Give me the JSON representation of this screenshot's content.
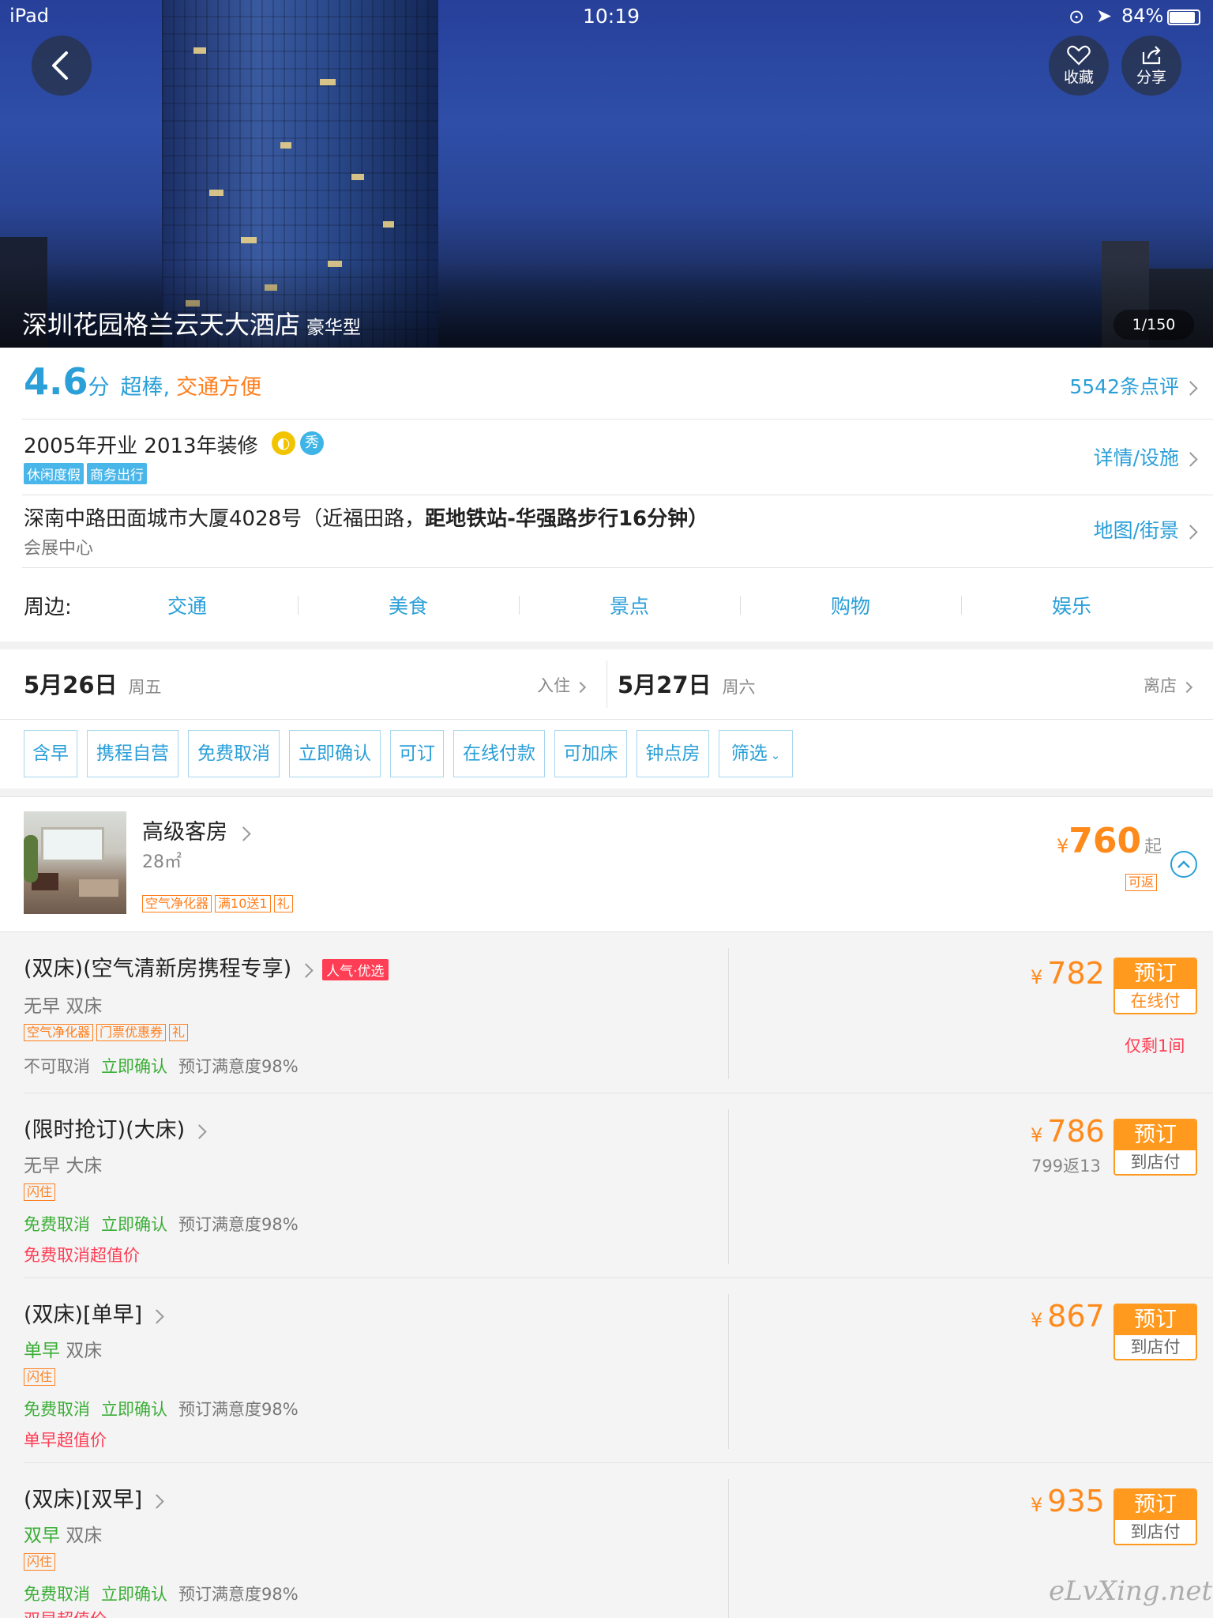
{
  "status_bar": {
    "device": "iPad",
    "time": "10:19",
    "battery": "84%"
  },
  "hero": {
    "name": "深圳花园格兰云天大酒店",
    "type": "豪华型",
    "photo_count": "1/150",
    "fav_label": "收藏",
    "share_label": "分享"
  },
  "rating": {
    "score": "4.6",
    "unit": "分",
    "desc_a": "超棒,",
    "desc_b": "交通方便",
    "reviews": "5542条点评"
  },
  "info": {
    "opening": "2005年开业 2013年装修",
    "badge_show": "秀",
    "tags": [
      "休闲度假",
      "商务出行"
    ],
    "detail_link": "详情/设施"
  },
  "address": {
    "line_a": "深南中路田面城市大厦4028号（近福田路，",
    "line_b": "距地铁站-华强路步行16分钟）",
    "area": "会展中心",
    "map_link": "地图/街景"
  },
  "nearby": {
    "label": "周边:",
    "items": [
      "交通",
      "美食",
      "景点",
      "购物",
      "娱乐"
    ]
  },
  "dates": {
    "checkin": "5月26日",
    "checkin_day": "周五",
    "checkin_label": "入住",
    "checkout": "5月27日",
    "checkout_day": "周六",
    "checkout_label": "离店"
  },
  "filters": [
    "含早",
    "携程自营",
    "免费取消",
    "立即确认",
    "可订",
    "在线付款",
    "可加床",
    "钟点房",
    "筛选"
  ],
  "room": {
    "name": "高级客房",
    "area": "28㎡",
    "tags": [
      "空气净化器",
      "满10送1",
      "礼"
    ],
    "currency": "¥",
    "price": "760",
    "price_suffix": "起",
    "rebate": "可返"
  },
  "rates": [
    {
      "title": "(双床)(空气清新房携程专享)",
      "badge": "人气·优选",
      "meal": "无早",
      "bed": "双床",
      "tags": [
        "空气净化器",
        "门票优惠券",
        "礼"
      ],
      "cancel": "不可取消",
      "confirm": "立即确认",
      "satisfaction": "预订满意度98%",
      "currency": "¥",
      "price": "782",
      "book": "预订",
      "pay": "在线付",
      "extra": "仅剩1间"
    },
    {
      "title": "(限时抢订)(大床)",
      "meal": "无早",
      "bed": "大床",
      "tags": [
        "闪住"
      ],
      "cancel": "免费取消",
      "confirm": "立即确认",
      "satisfaction": "预订满意度98%",
      "note": "免费取消超值价",
      "currency": "¥",
      "price": "786",
      "sub_price": "799返13",
      "book": "预订",
      "pay": "到店付"
    },
    {
      "title": "(双床)[单早]",
      "meal": "单早",
      "bed": "双床",
      "tags": [
        "闪住"
      ],
      "cancel": "免费取消",
      "confirm": "立即确认",
      "satisfaction": "预订满意度98%",
      "note": "单早超值价",
      "currency": "¥",
      "price": "867",
      "book": "预订",
      "pay": "到店付"
    },
    {
      "title": "(双床)[双早]",
      "meal": "双早",
      "bed": "双床",
      "tags": [
        "闪住"
      ],
      "cancel": "免费取消",
      "confirm": "立即确认",
      "satisfaction": "预订满意度98%",
      "note": "双早超值价",
      "currency": "¥",
      "price": "935",
      "book": "预订",
      "pay": "到店付"
    }
  ],
  "watermark": "eLvXing.net"
}
